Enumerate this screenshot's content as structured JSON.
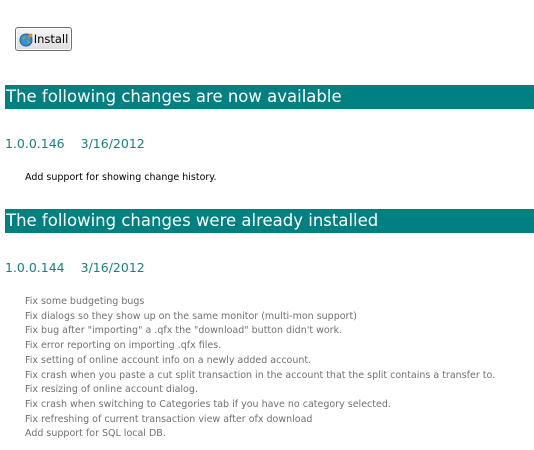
{
  "toolbar": {
    "install_label": "Install",
    "install_icon": "globe-install-icon"
  },
  "available": {
    "heading": "The following changes are now available",
    "version": "1.0.0.146",
    "date": "3/16/2012",
    "description": "Add support for showing change history."
  },
  "installed": {
    "heading": "The following changes were already installed",
    "version": "1.0.0.144",
    "date": "3/16/2012",
    "changes": [
      "Fix some budgeting bugs",
      "Fix dialogs so they show up on the same monitor (multi-mon support)",
      "Fix bug after \"importing\" a .qfx the \"download\" button didn't work.",
      "Fix error reporting on importing .qfx files.",
      "Fix setting of online account info on a newly added account.",
      "Fix crash when you paste a cut split transaction in the account that the split contains a transfer to.",
      "Fix resizing of online account dialog.",
      "Fix crash when switching to Categories tab if you have no category selected.",
      "Fix refreshing of current transaction view after ofx download",
      "Add support for SQL local DB."
    ]
  },
  "colors": {
    "banner": "#008080",
    "version_text": "#1a7f7f",
    "fix_text": "#707070"
  }
}
